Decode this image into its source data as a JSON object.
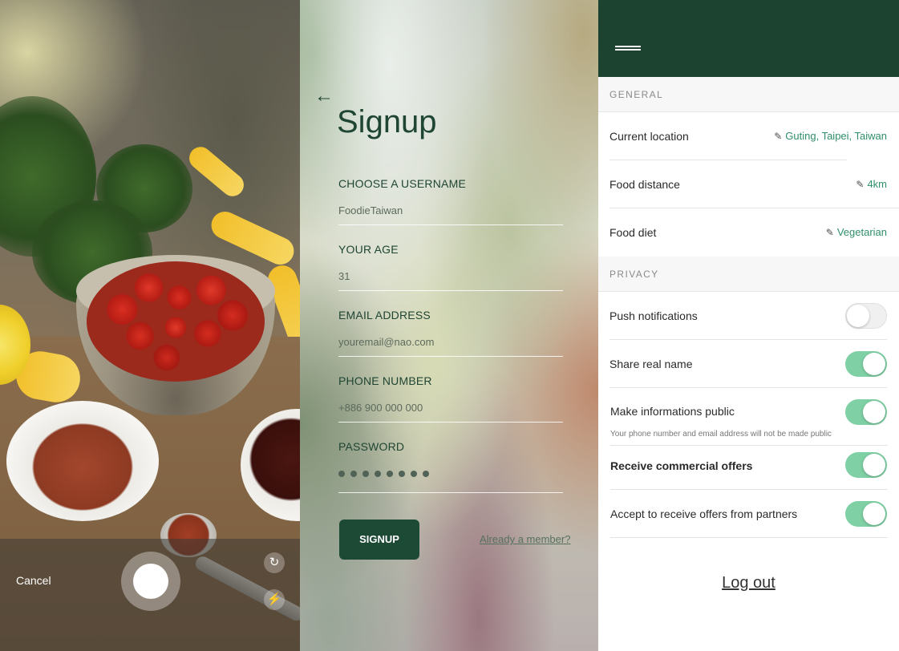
{
  "camera": {
    "cancel_label": "Cancel",
    "icons": {
      "shutter": "shutter-icon",
      "switch": "switch-camera-icon",
      "flash": "flash-icon"
    }
  },
  "signup": {
    "title": "Signup",
    "fields": [
      {
        "label": "CHOOSE A USERNAME",
        "value": "FoodieTaiwan"
      },
      {
        "label": "YOUR AGE",
        "value": "31"
      },
      {
        "label": "EMAIL ADDRESS",
        "value": "youremail@nao.com"
      },
      {
        "label": "PHONE NUMBER",
        "value": "+886 900 000 000"
      },
      {
        "label": "PASSWORD",
        "masked_length": 8
      }
    ],
    "submit_label": "SIGNUP",
    "already_member_label": "Already a member?"
  },
  "settings": {
    "general_header": "GENERAL",
    "location": {
      "label": "Current location",
      "value": "Guting, Taipei, Taiwan"
    },
    "distance": {
      "label": "Food distance",
      "value": "4km"
    },
    "diet": {
      "label": "Food diet",
      "value": "Vegetarian"
    },
    "privacy_header": "PRIVACY",
    "push": {
      "label": "Push notifications",
      "on": false
    },
    "share_name": {
      "label": "Share real name",
      "on": true
    },
    "public_info": {
      "label": "Make informations public",
      "hint": "Your phone number and email address will not be made public",
      "on": true
    },
    "commercial": {
      "label": "Receive commercial offers",
      "on": true
    },
    "partners": {
      "label": "Accept to receive offers from partners",
      "on": true
    },
    "logout_label": "Log out"
  },
  "colors": {
    "header_green": "#1c4230",
    "button_green": "#1c4a35",
    "toggle_on": "#7fd0a4",
    "link_green": "#2f8f6a"
  }
}
